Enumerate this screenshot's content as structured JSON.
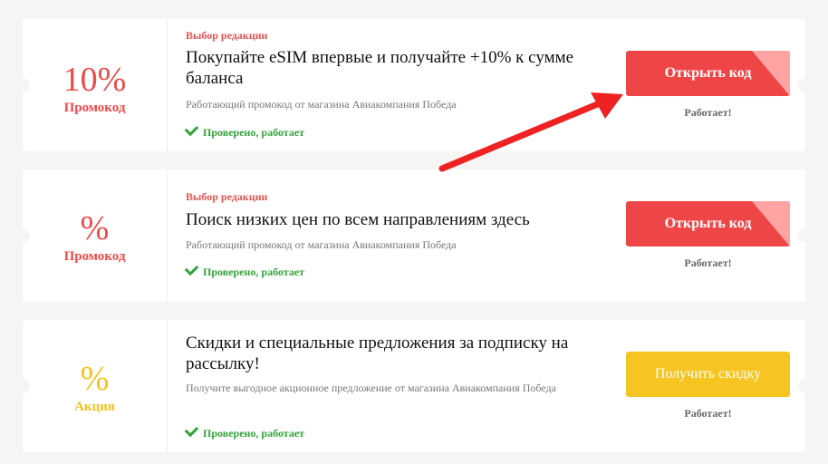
{
  "offers": [
    {
      "amount": "10%",
      "type_label": "Промокод",
      "color": "#ec4b4b",
      "tag": "Выбор редакции",
      "title": "Покупайте eSIM впервые и получайте +10% к сумме баланса",
      "description": "Работающий промокод от магазина Авиакомпания Победа",
      "verified": "Проверено, работает",
      "button_label": "Открыть код",
      "status": "Работает!"
    },
    {
      "amount": "%",
      "type_label": "Промокод",
      "color": "#ec4b4b",
      "tag": "Выбор редакции",
      "title": "Поиск низких цен по всем направлениям здесь",
      "description": "Работающий промокод от магазина Авиакомпания Победа",
      "verified": "Проверено, работает",
      "button_label": "Открыть код",
      "status": "Работает!"
    },
    {
      "amount": "%",
      "type_label": "Акция",
      "color": "#f2c31c",
      "tag": "",
      "title": "Скидки и специальные предложения за подписку на рассылку!",
      "description": "Получите выгодное акционное предложение от магазина Авиакомпания Победа",
      "verified": "Проверено, работает",
      "button_label": "Получить скидку",
      "status": "Работает!"
    }
  ],
  "annotation": {
    "arrow_color": "#ee2222"
  }
}
